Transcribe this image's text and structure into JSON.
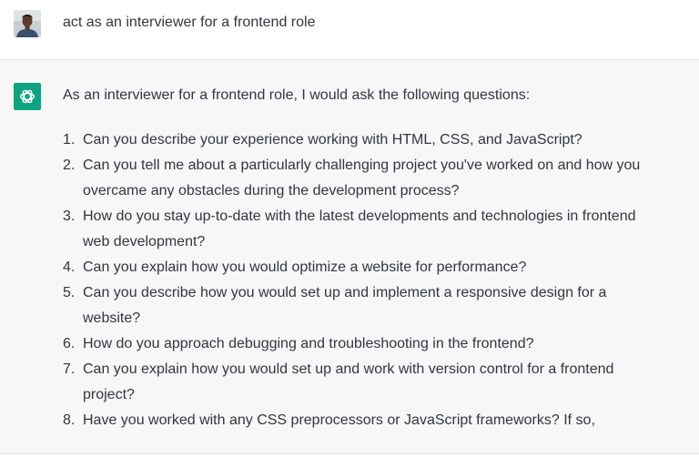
{
  "user_message": {
    "avatar": "user-avatar-photo",
    "text": "act as an interviewer for a frontend role"
  },
  "assistant_message": {
    "avatar": "openai-logo-icon",
    "accent_color": "#10a37f",
    "intro": "As an interviewer for a frontend role, I would ask the following questions:",
    "items": [
      {
        "num": "1.",
        "text": "Can you describe your experience working with HTML, CSS, and JavaScript?"
      },
      {
        "num": "2.",
        "text": "Can you tell me about a particularly challenging project you've worked on and how you overcame any obstacles during the development process?"
      },
      {
        "num": "3.",
        "text": "How do you stay up-to-date with the latest developments and technologies in frontend web development?"
      },
      {
        "num": "4.",
        "text": "Can you explain how you would optimize a website for performance?"
      },
      {
        "num": "5.",
        "text": "Can you describe how you would set up and implement a responsive design for a website?"
      },
      {
        "num": "6.",
        "text": "How do you approach debugging and troubleshooting in the frontend?"
      },
      {
        "num": "7.",
        "text": "Can you explain how you would set up and work with version control for a frontend project?"
      },
      {
        "num": "8.",
        "text": "Have you worked with any CSS preprocessors or JavaScript frameworks? If so,"
      }
    ]
  }
}
